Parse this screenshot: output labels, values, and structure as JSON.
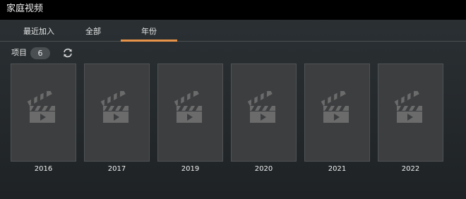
{
  "app": {
    "title": "家庭视频"
  },
  "tabs": [
    {
      "label": "最近加入",
      "active": false
    },
    {
      "label": "全部",
      "active": false
    },
    {
      "label": "年份",
      "active": true
    }
  ],
  "toolbar": {
    "items_label": "项目",
    "items_count": "6",
    "refresh_icon": "refresh-icon"
  },
  "colors": {
    "accent": "#e8934a",
    "titlebar_bg": "#000000",
    "card_bg": "#3c3e40",
    "placeholder_icon": "#6b6b6b"
  },
  "cards": [
    {
      "label": "2016",
      "icon": "clapperboard-icon"
    },
    {
      "label": "2017",
      "icon": "clapperboard-icon"
    },
    {
      "label": "2019",
      "icon": "clapperboard-icon"
    },
    {
      "label": "2020",
      "icon": "clapperboard-icon"
    },
    {
      "label": "2021",
      "icon": "clapperboard-icon"
    },
    {
      "label": "2022",
      "icon": "clapperboard-icon"
    }
  ]
}
